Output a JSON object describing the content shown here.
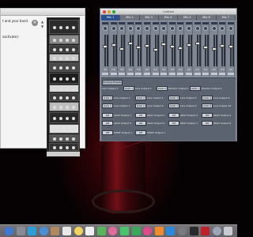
{
  "left_window": {
    "line1": "t and your band.",
    "line2": "s",
    "line2_suffix": "activate):",
    "close_label": "×"
  },
  "mixer_window": {
    "title": "Untitled",
    "tabs": [
      "Mix 1",
      "Mix 2",
      "Mix 3",
      "Mix 4",
      "Mix 5",
      "Mix 6",
      "Mix 7"
    ],
    "fader_values": [
      "0.0",
      "0.0",
      "0.0",
      "0.0",
      "0.0",
      "0.0",
      "0.0",
      "0.0",
      "0.0",
      "0.0",
      "0.0",
      "0.0",
      "0.0",
      "0.0",
      "0.0",
      "0.0"
    ]
  },
  "routing": {
    "headers": [
      "Routing Presets"
    ],
    "rows": [
      [
        {
          "kind": "text",
          "text": "Line Output 1"
        },
        {
          "kind": "button",
          "text": "DAW 1"
        },
        {
          "kind": "text",
          "text": "Line Output 2"
        },
        {
          "kind": "button",
          "text": "DAW 2"
        },
        {
          "kind": "text",
          "text": "Monitor Output 1"
        },
        {
          "kind": "button",
          "text": "DAW 1"
        },
        {
          "kind": "text",
          "text": "Monitor Output 2"
        }
      ],
      [
        {
          "kind": "button",
          "text": "DAW 1"
        },
        {
          "kind": "text",
          "text": "Line Output 3"
        },
        {
          "kind": "button",
          "text": "DAW 2"
        },
        {
          "kind": "text",
          "text": "Line Output 4"
        },
        {
          "kind": "button",
          "text": "DAW 3"
        },
        {
          "kind": "text",
          "text": "Line Output 5"
        },
        {
          "kind": "button",
          "text": "DAW 4"
        },
        {
          "kind": "text",
          "text": "Line Output 6"
        }
      ],
      [
        {
          "kind": "button",
          "text": "DAW 5"
        },
        {
          "kind": "text",
          "text": "Line Output 7"
        },
        {
          "kind": "button",
          "text": "DAW 6"
        },
        {
          "kind": "text",
          "text": "Line Output 8"
        },
        {
          "kind": "button",
          "text": "DAW 7"
        },
        {
          "kind": "text",
          "text": "Line Output 9"
        },
        {
          "kind": "button",
          "text": "DAW 8"
        },
        {
          "kind": "text",
          "text": "Line Output 10"
        }
      ],
      [
        {
          "kind": "button",
          "text": "Off"
        },
        {
          "kind": "text",
          "text": "ADAT Output 1"
        },
        {
          "kind": "button",
          "text": "Off"
        },
        {
          "kind": "text",
          "text": "ADAT Output 2"
        },
        {
          "kind": "button",
          "text": "Off"
        },
        {
          "kind": "text",
          "text": "ADAT Output 3"
        },
        {
          "kind": "button",
          "text": "Off"
        },
        {
          "kind": "text",
          "text": "ADAT Output 4"
        }
      ],
      [
        {
          "kind": "button",
          "text": "Off"
        },
        {
          "kind": "text",
          "text": "ADAT Output 5"
        },
        {
          "kind": "button",
          "text": "Off"
        },
        {
          "kind": "text",
          "text": "ADAT Output 6"
        },
        {
          "kind": "button",
          "text": "Off"
        },
        {
          "kind": "text",
          "text": "ADAT Output 7"
        },
        {
          "kind": "button",
          "text": "Off"
        },
        {
          "kind": "text",
          "text": "ADAT Output 8"
        }
      ],
      [
        {
          "kind": "button",
          "text": "Off"
        },
        {
          "kind": "text",
          "text": "SPDIF Output 1"
        },
        {
          "kind": "button",
          "text": "Off"
        },
        {
          "kind": "text",
          "text": "SPDIF Output 2"
        }
      ]
    ]
  },
  "dock": {
    "icons": [
      {
        "name": "finder-icon",
        "color": "#3a7bd5"
      },
      {
        "name": "launchpad-icon",
        "color": "#8a8a95"
      },
      {
        "name": "safari-icon",
        "color": "#2a9fd8"
      },
      {
        "name": "mail-icon",
        "color": "#4a90d9"
      },
      {
        "name": "contacts-icon",
        "color": "#b08a5a"
      },
      {
        "name": "calendar-icon",
        "color": "#e8e8e8"
      },
      {
        "name": "notes-icon",
        "color": "#f2d35a"
      },
      {
        "name": "reminders-icon",
        "color": "#f0f0f0"
      },
      {
        "name": "maps-icon",
        "color": "#5ab55a"
      },
      {
        "name": "photos-icon",
        "color": "#e06a9a"
      },
      {
        "name": "messages-icon",
        "color": "#4ac46a"
      },
      {
        "name": "facetime-icon",
        "color": "#3aa85a"
      },
      {
        "name": "itunes-icon",
        "color": "#e04a8a"
      },
      {
        "name": "ibooks-icon",
        "color": "#f08a2a"
      },
      {
        "name": "app-store-icon",
        "color": "#2a8ae0"
      },
      {
        "name": "system-preferences-icon",
        "color": "#7a7a82"
      },
      {
        "name": "music-app-icon",
        "color": "#2a2a2a"
      },
      {
        "name": "audio-app-icon",
        "color": "#c0202a"
      },
      {
        "name": "downloads-icon",
        "color": "#9aa6b8"
      },
      {
        "name": "trash-icon",
        "color": "#c8ccd2"
      }
    ]
  }
}
